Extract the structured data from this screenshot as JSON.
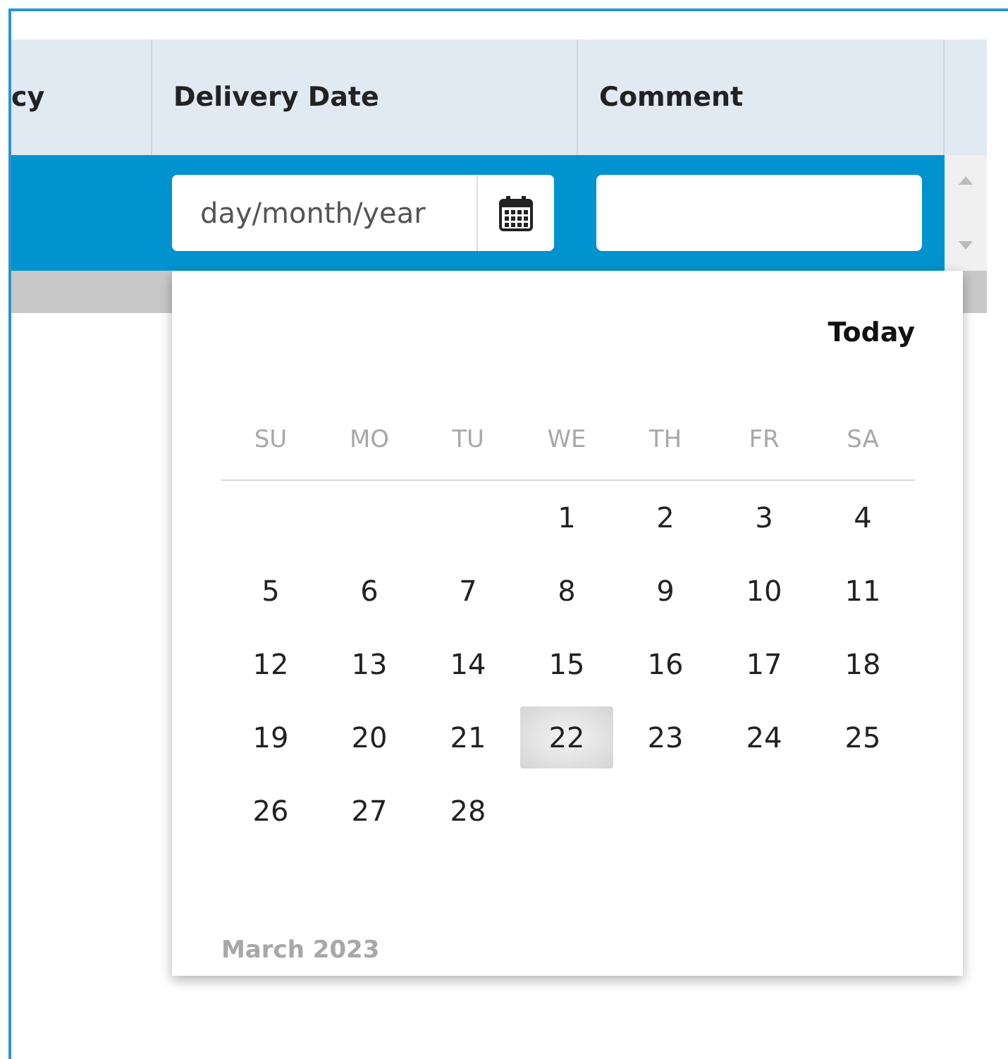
{
  "table": {
    "columns": [
      "cy",
      "Delivery Date",
      "Comment"
    ],
    "row": {
      "selected": true,
      "delivery_date": {
        "placeholder": "day/month/year"
      }
    }
  },
  "datepicker": {
    "today_label": "Today",
    "weekdays": [
      "SU",
      "MO",
      "TU",
      "WE",
      "TH",
      "FR",
      "SA"
    ],
    "weeks": [
      [
        {
          "kind": "blank"
        },
        {
          "kind": "blank"
        },
        {
          "kind": "blank"
        },
        {
          "kind": "day",
          "day": "1",
          "selected": false
        },
        {
          "kind": "day",
          "day": "2",
          "selected": false
        },
        {
          "kind": "day",
          "day": "3",
          "selected": false
        },
        {
          "kind": "day",
          "day": "4",
          "selected": false
        }
      ],
      [
        {
          "kind": "day",
          "day": "5",
          "selected": false
        },
        {
          "kind": "day",
          "day": "6",
          "selected": false
        },
        {
          "kind": "day",
          "day": "7",
          "selected": false
        },
        {
          "kind": "day",
          "day": "8",
          "selected": false
        },
        {
          "kind": "day",
          "day": "9",
          "selected": false
        },
        {
          "kind": "day",
          "day": "10",
          "selected": false
        },
        {
          "kind": "day",
          "day": "11",
          "selected": false
        }
      ],
      [
        {
          "kind": "day",
          "day": "12",
          "selected": false
        },
        {
          "kind": "day",
          "day": "13",
          "selected": false
        },
        {
          "kind": "day",
          "day": "14",
          "selected": false
        },
        {
          "kind": "day",
          "day": "15",
          "selected": false
        },
        {
          "kind": "day",
          "day": "16",
          "selected": false
        },
        {
          "kind": "day",
          "day": "17",
          "selected": false
        },
        {
          "kind": "day",
          "day": "18",
          "selected": false
        }
      ],
      [
        {
          "kind": "day",
          "day": "19",
          "selected": false
        },
        {
          "kind": "day",
          "day": "20",
          "selected": false
        },
        {
          "kind": "day",
          "day": "21",
          "selected": false
        },
        {
          "kind": "day",
          "day": "22",
          "selected": true
        },
        {
          "kind": "day",
          "day": "23",
          "selected": false
        },
        {
          "kind": "day",
          "day": "24",
          "selected": false
        },
        {
          "kind": "day",
          "day": "25",
          "selected": false
        }
      ],
      [
        {
          "kind": "day",
          "day": "26",
          "selected": false
        },
        {
          "kind": "day",
          "day": "27",
          "selected": false
        },
        {
          "kind": "day",
          "day": "28",
          "selected": false
        },
        {
          "kind": "blank"
        },
        {
          "kind": "blank"
        },
        {
          "kind": "blank"
        },
        {
          "kind": "blank"
        }
      ]
    ],
    "footer": "March 2023"
  }
}
